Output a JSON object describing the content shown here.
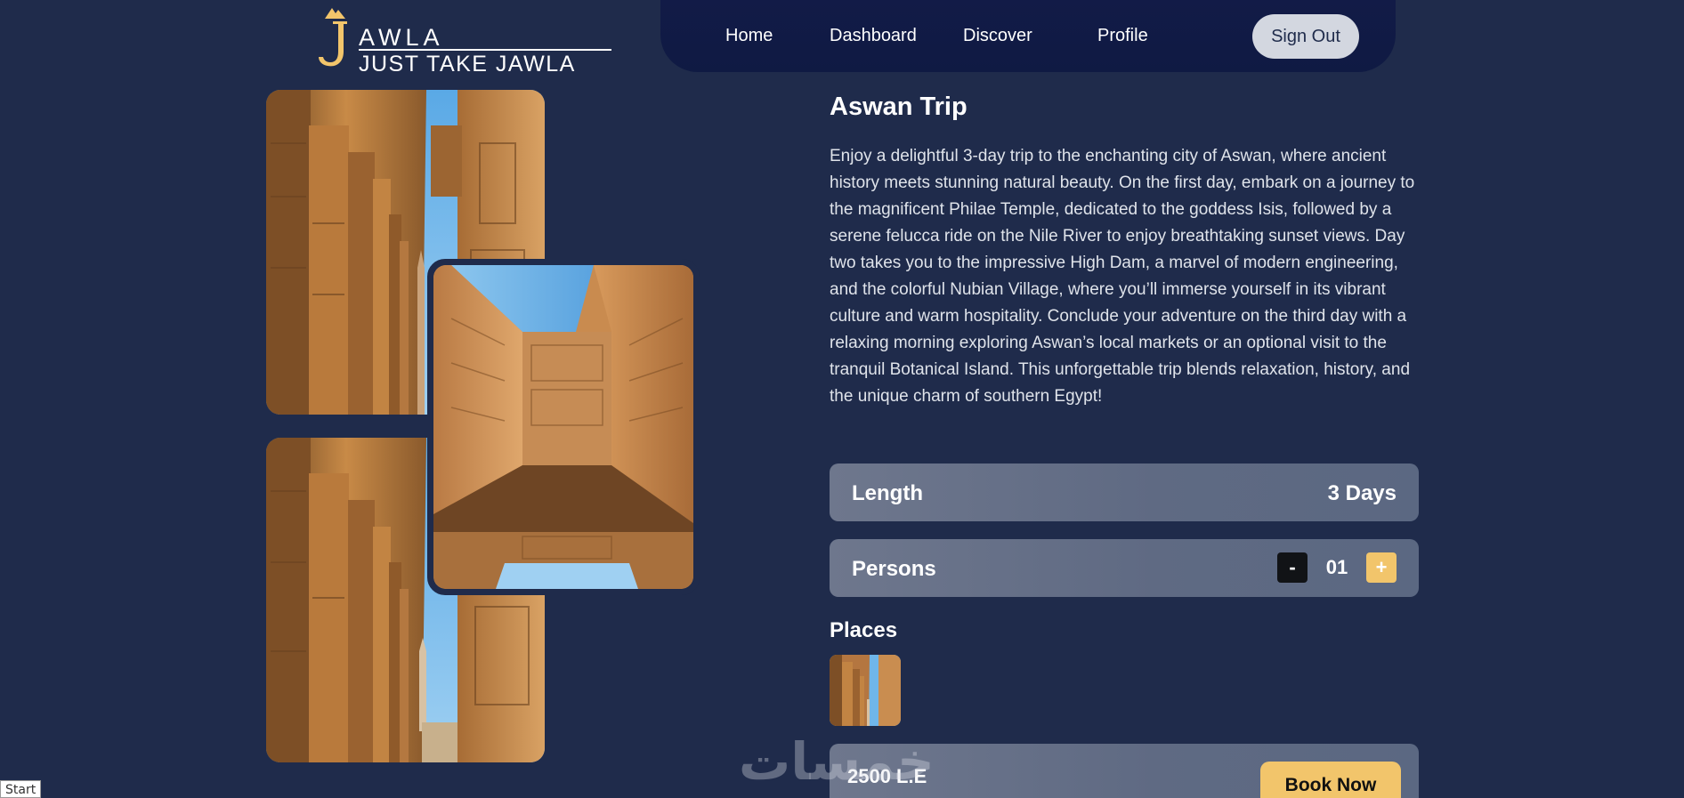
{
  "brand": {
    "name": "AWLA",
    "tagline": "JUST TAKE JAWLA",
    "accent": "#f2c56b"
  },
  "nav": {
    "items": [
      {
        "label": "Home"
      },
      {
        "label": "Dashboard"
      },
      {
        "label": "Discover"
      },
      {
        "label": "Profile"
      }
    ],
    "sign_out": "Sign Out"
  },
  "trip": {
    "title": "Aswan Trip",
    "description": "Enjoy a delightful 3-day trip to the enchanting city of Aswan, where ancient history meets stunning natural beauty. On the first day, embark on a journey to the magnificent Philae Temple, dedicated to the goddess Isis, followed by a serene felucca ride on the Nile River to enjoy breathtaking sunset views. Day two takes you to the impressive High Dam, a marvel of modern engineering, and the colorful Nubian Village, where you’ll immerse yourself in its vibrant culture and warm hospitality. Conclude your adventure on the third day with a relaxing morning exploring Aswan’s local markets or an optional visit to the tranquil Botanical Island. This unforgettable trip blends relaxation, history, and the unique charm of southern Egypt!",
    "length_label": "Length",
    "length_value": "3 Days",
    "persons_label": "Persons",
    "persons_count": "01",
    "minus": "-",
    "plus": "+",
    "places_title": "Places",
    "price": "2500 L.E",
    "book_now": "Book Now"
  },
  "watermark": "خمسات",
  "status": {
    "start": "Start"
  },
  "colors": {
    "background": "#1f2b4b",
    "nav_bg": "#121b47",
    "row_bg": "#6e778d",
    "minus_bg": "#111316",
    "plus_bg": "#f2c56b",
    "sign_out_bg": "#d3d7e0"
  }
}
